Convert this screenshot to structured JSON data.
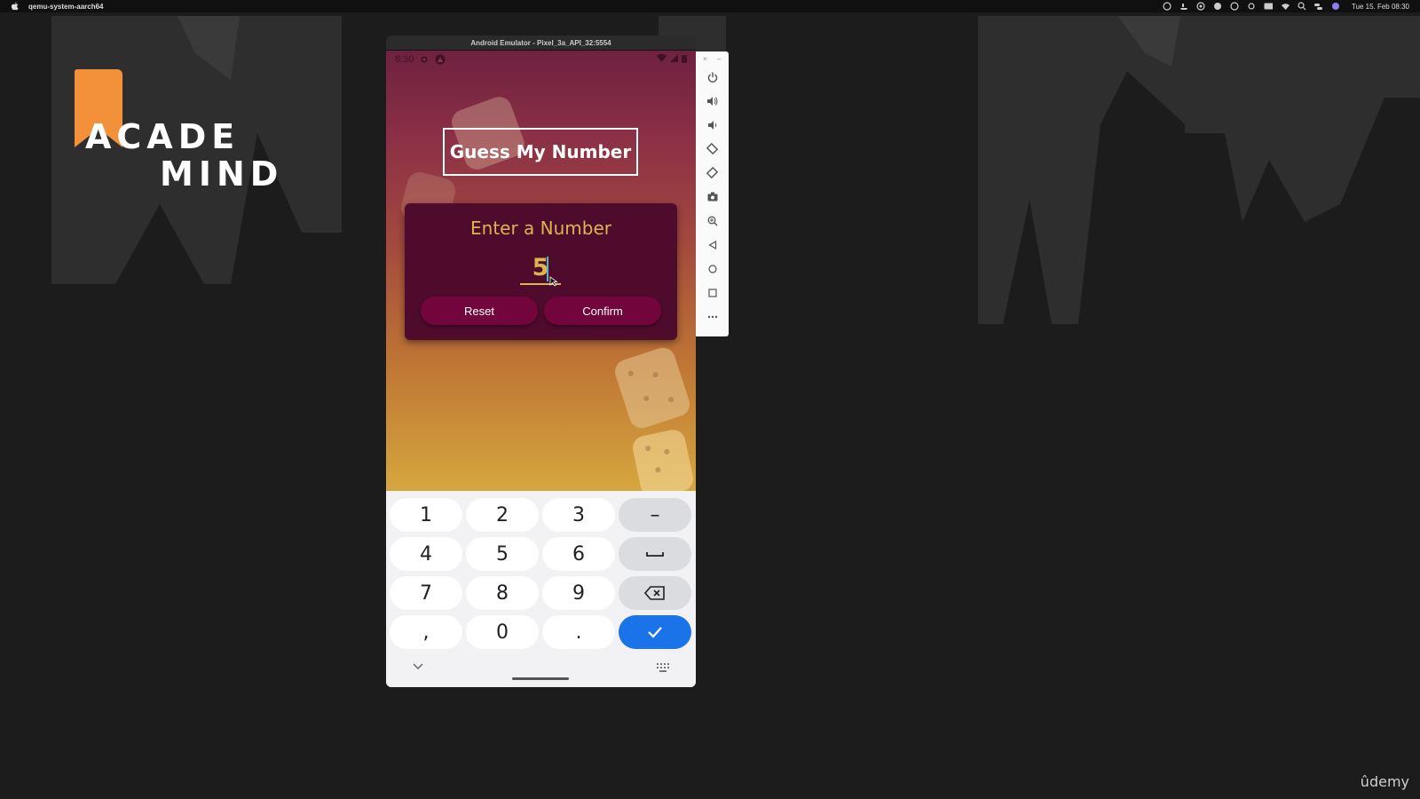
{
  "menubar": {
    "app_name": "qemu-system-aarch64",
    "clock": "Tue 15. Feb  08:30",
    "icons": [
      "status-icon-1",
      "status-icon-2",
      "status-icon-3",
      "status-icon-4",
      "status-icon-5",
      "status-icon-6",
      "battery-icon",
      "wifi-icon",
      "search-icon",
      "control-center-icon",
      "siri-icon"
    ]
  },
  "logo": {
    "line1": "ACADE",
    "line2": "MIND",
    "accent_color": "#f3913a"
  },
  "emulator": {
    "window_title": "Android Emulator - Pixel_3a_API_32:5554",
    "statusbar": {
      "time": "8:30"
    },
    "toolbar": {
      "close": "×",
      "minimize": "–",
      "buttons": [
        "power-icon",
        "volume-up-icon",
        "volume-down-icon",
        "rotate-left-icon",
        "rotate-right-icon",
        "camera-icon",
        "zoom-icon",
        "back-icon",
        "home-icon",
        "overview-icon",
        "more-icon"
      ]
    }
  },
  "app": {
    "title": "Guess My Number",
    "input_card": {
      "label": "Enter a Number",
      "value": "5",
      "reset_label": "Reset",
      "confirm_label": "Confirm"
    },
    "colors": {
      "card": "#4e0b2c",
      "button": "#72063c",
      "accent": "#ddb452"
    }
  },
  "keyboard": {
    "rows": [
      [
        "1",
        "2",
        "3",
        "–"
      ],
      [
        "4",
        "5",
        "6",
        "␣"
      ],
      [
        "7",
        "8",
        "9",
        "⌫"
      ],
      [
        ",",
        "0",
        ".",
        "✓"
      ]
    ],
    "done_color": "#1a73e8"
  },
  "watermark": "ûdemy"
}
